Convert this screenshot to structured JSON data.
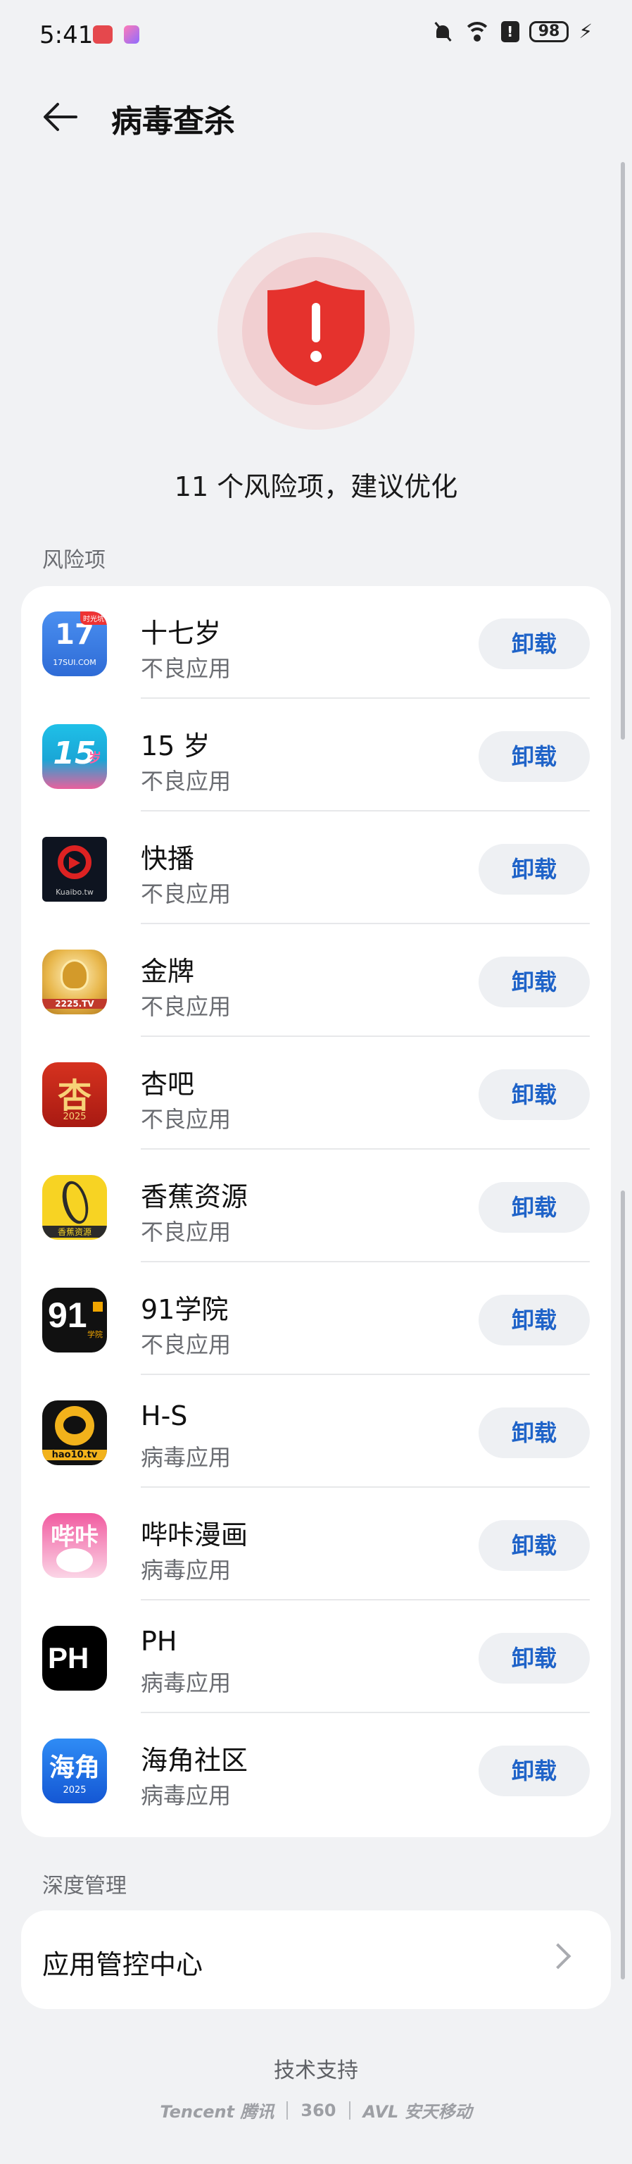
{
  "status_bar": {
    "time": "5:41",
    "signal_badge": "6",
    "battery": "98",
    "icons": [
      "mute-icon",
      "wifi-icon",
      "alert-icon",
      "battery-icon",
      "charging-icon"
    ]
  },
  "header": {
    "title": "病毒查杀",
    "back_icon": "arrow-left-icon"
  },
  "hero": {
    "summary": "11 个风险项，建议优化",
    "icon": "shield-alert-icon",
    "accent": "#e5322d"
  },
  "risk_section": {
    "label": "风险项",
    "button_label": "卸载",
    "items": [
      {
        "name": "十七岁",
        "type": "不良应用",
        "icon": "app-17sui-icon",
        "icon_text": "17",
        "icon_sub": "17SUI.COM",
        "icon_tag": "时光坑"
      },
      {
        "name": "15 岁",
        "type": "不良应用",
        "icon": "app-15sui-icon",
        "icon_text": "15",
        "icon_tag": "岁"
      },
      {
        "name": "快播",
        "type": "不良应用",
        "icon": "app-kuaibo-icon",
        "icon_text": "Q",
        "icon_sub": "Kuaibo.tw"
      },
      {
        "name": "金牌",
        "type": "不良应用",
        "icon": "app-jinpai-icon",
        "icon_sub": "2225.TV"
      },
      {
        "name": "杏吧",
        "type": "不良应用",
        "icon": "app-xingba-icon",
        "icon_text": "杏",
        "icon_sub": "2025"
      },
      {
        "name": "香蕉资源",
        "type": "不良应用",
        "icon": "app-banana-icon",
        "icon_sub": "香蕉资源"
      },
      {
        "name": "91学院",
        "type": "不良应用",
        "icon": "app-91-icon",
        "icon_text": "91",
        "icon_tag": "学院"
      },
      {
        "name": "H-S",
        "type": "病毒应用",
        "icon": "app-hs-icon",
        "icon_sub": "hao10.tv"
      },
      {
        "name": "哔咔漫画",
        "type": "病毒应用",
        "icon": "app-picacomic-icon",
        "icon_text": "哔咔"
      },
      {
        "name": "PH",
        "type": "病毒应用",
        "icon": "app-ph-icon",
        "icon_text": "PH"
      },
      {
        "name": "海角社区",
        "type": "病毒应用",
        "icon": "app-haijiao-icon",
        "icon_text": "海角",
        "icon_sub": "2025"
      }
    ]
  },
  "deep_section": {
    "label": "深度管理",
    "item_label": "应用管控中心",
    "chevron_icon": "chevron-right-icon"
  },
  "footer": {
    "support": "技术支持",
    "brand1": "Tencent",
    "brand1_cn": "腾讯",
    "brand2": "360",
    "brand3": "AVL",
    "brand3_cn": "安天移动"
  },
  "colors": {
    "background": "#f1f2f4",
    "card": "#ffffff",
    "button_text": "#1f63c8",
    "button_bg": "#eef0f3"
  }
}
